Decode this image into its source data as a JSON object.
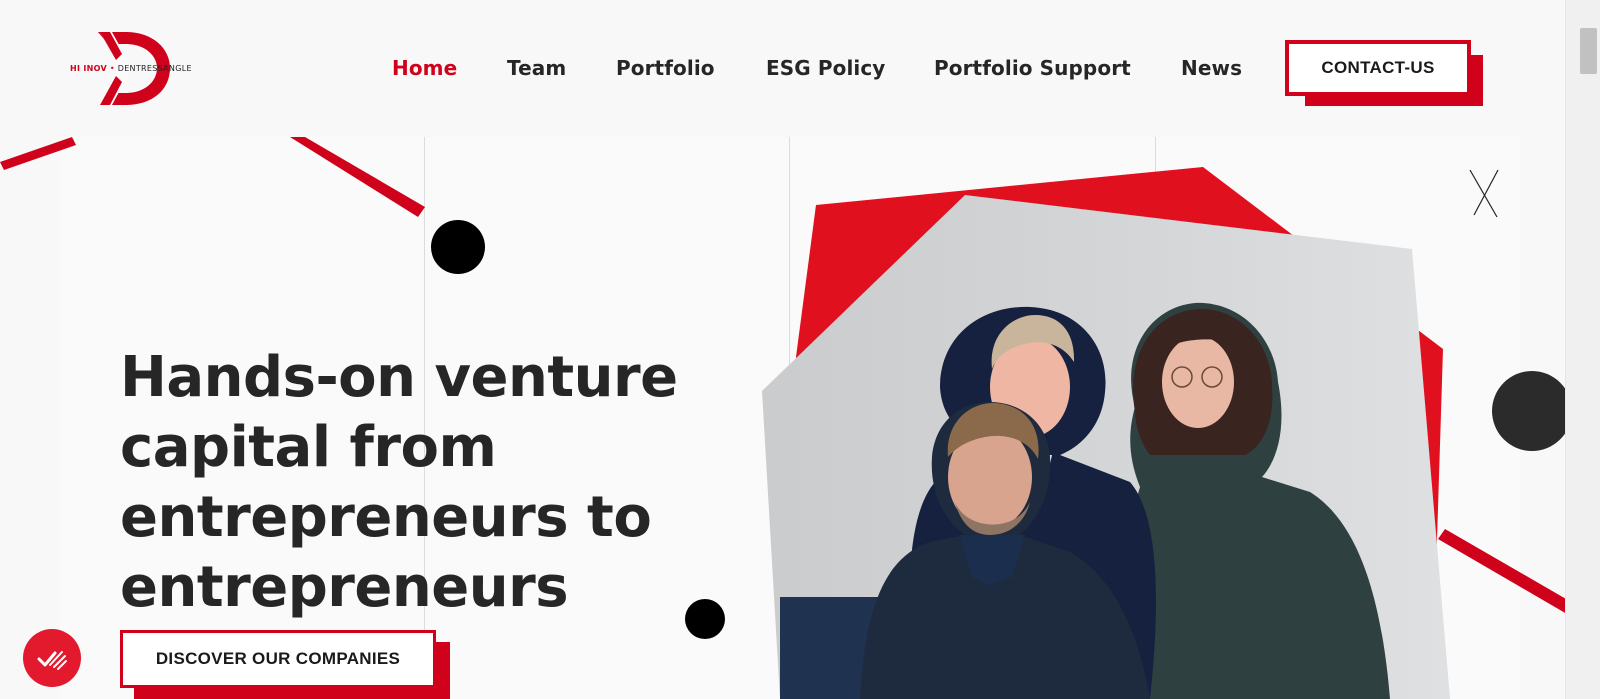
{
  "brand": {
    "logo_left": "HI INOV",
    "logo_separator": "•",
    "logo_right": "DENTRESSANGLE",
    "accent_color": "#d0021b",
    "text_color": "#262626"
  },
  "nav": {
    "items": [
      {
        "label": "Home",
        "active": true
      },
      {
        "label": "Team",
        "active": false
      },
      {
        "label": "Portfolio",
        "active": false
      },
      {
        "label": "ESG Policy",
        "active": false
      },
      {
        "label": "Portfolio Support",
        "active": false
      },
      {
        "label": "News",
        "active": false
      }
    ],
    "contact_label": "CONTACT-US"
  },
  "hero": {
    "headline_lines": [
      "Hands-on venture",
      "capital from",
      "entrepreneurs to",
      "entrepreneurs"
    ],
    "cta_label": "DISCOVER OUR COMPANIES"
  },
  "icons": {
    "close": "close-icon",
    "chat": "chat-check-icon",
    "photo": "team-photo"
  }
}
